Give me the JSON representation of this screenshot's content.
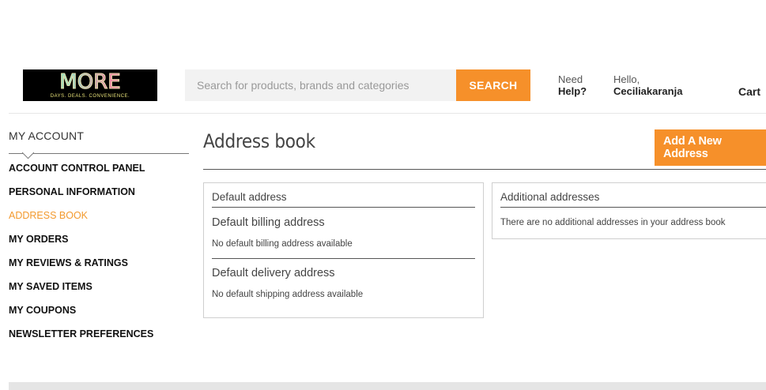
{
  "header": {
    "logo": {
      "word": "MORE",
      "tagline": "DAYS. DEALS. CONVENIENCE."
    },
    "search": {
      "placeholder": "Search for products, brands and categories",
      "value": "",
      "button_label": "SEARCH"
    },
    "help": {
      "line1": "Need",
      "line2": "Help?"
    },
    "account": {
      "greeting": "Hello,",
      "username": "Ceciliakaranja"
    },
    "cart_label": "Cart"
  },
  "sidebar": {
    "title": "MY ACCOUNT",
    "items": [
      {
        "label": "ACCOUNT CONTROL PANEL",
        "active": false
      },
      {
        "label": "PERSONAL INFORMATION",
        "active": false
      },
      {
        "label": "ADDRESS BOOK",
        "active": true
      },
      {
        "label": "MY ORDERS",
        "active": false
      },
      {
        "label": "MY REVIEWS & RATINGS",
        "active": false
      },
      {
        "label": "MY SAVED ITEMS",
        "active": false
      },
      {
        "label": "MY COUPONS",
        "active": false
      },
      {
        "label": "NEWSLETTER PREFERENCES",
        "active": false
      }
    ]
  },
  "main": {
    "title": "Address book",
    "add_button": "Add A New Address",
    "default_box": {
      "header": "Default address",
      "billing_title": "Default billing address",
      "billing_text": "No default billing address available",
      "delivery_title": "Default delivery address",
      "delivery_text": "No default shipping address available"
    },
    "additional_box": {
      "header": "Additional addresses",
      "text": "There are no additional addresses in your address book"
    }
  },
  "colors": {
    "accent": "#f6902a",
    "active_link": "#f39a2e",
    "text": "#333333"
  }
}
